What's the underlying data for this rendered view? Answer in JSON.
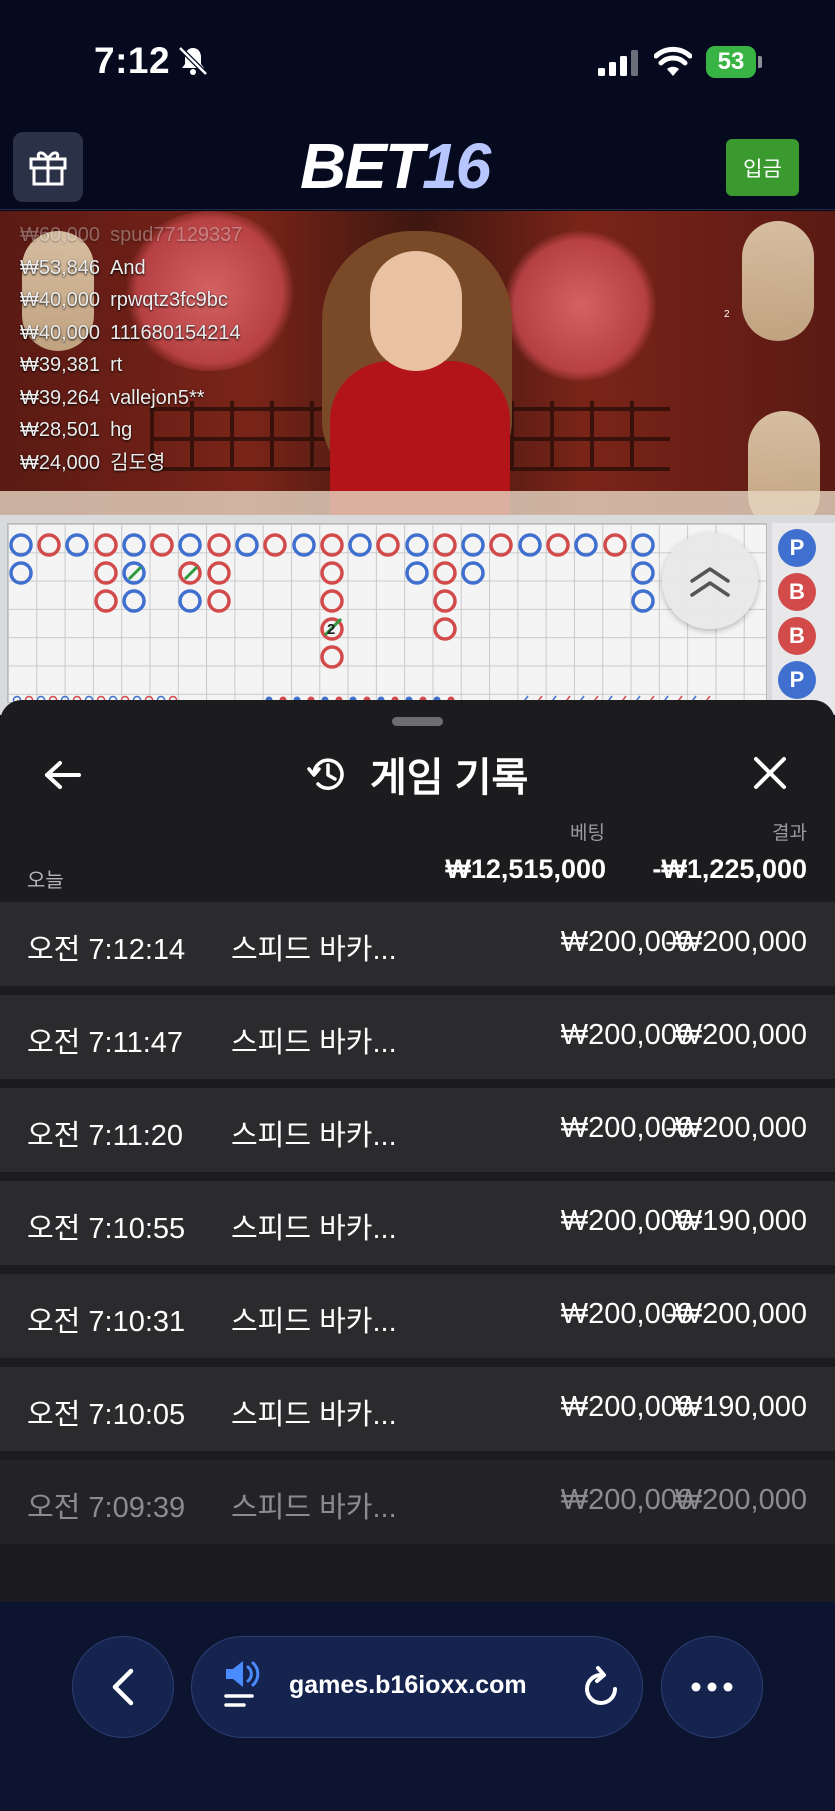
{
  "status_bar": {
    "time": "7:12",
    "battery": "53"
  },
  "header": {
    "logo_part1": "BET",
    "logo_part2": "16",
    "deposit_label": "입금"
  },
  "video": {
    "winners": [
      {
        "amount": "₩60,000",
        "name": "spud77129337"
      },
      {
        "amount": "₩53,846",
        "name": "And"
      },
      {
        "amount": "₩40,000",
        "name": "rpwqtz3fc9bc"
      },
      {
        "amount": "₩40,000",
        "name": "111680154214"
      },
      {
        "amount": "₩39,381",
        "name": "rt"
      },
      {
        "amount": "₩39,264",
        "name": "vallejon5**"
      },
      {
        "amount": "₩28,501",
        "name": "hg"
      },
      {
        "amount": "₩24,000",
        "name": "김도영"
      }
    ],
    "overlay_number": "2"
  },
  "roadmap": {
    "tie_count_label": "2",
    "side_results": [
      "P",
      "B",
      "B",
      "P"
    ]
  },
  "history": {
    "title": "게임 기록",
    "bet_col": "베팅",
    "result_col": "결과",
    "today_label": "오늘",
    "today_bet_total": "₩12,515,000",
    "today_result_total": "-₩1,225,000",
    "rows": [
      {
        "time": "오전 7:12:14",
        "game": "스피드 바카...",
        "bet": "₩200,000",
        "result": "-₩200,000"
      },
      {
        "time": "오전 7:11:47",
        "game": "스피드 바카...",
        "bet": "₩200,000",
        "result": "₩200,000"
      },
      {
        "time": "오전 7:11:20",
        "game": "스피드 바카...",
        "bet": "₩200,000",
        "result": "-₩200,000"
      },
      {
        "time": "오전 7:10:55",
        "game": "스피드 바카...",
        "bet": "₩200,000",
        "result": "₩190,000"
      },
      {
        "time": "오전 7:10:31",
        "game": "스피드 바카...",
        "bet": "₩200,000",
        "result": "-₩200,000"
      },
      {
        "time": "오전 7:10:05",
        "game": "스피드 바카...",
        "bet": "₩200,000",
        "result": "₩190,000"
      },
      {
        "time": "오전 7:09:39",
        "game": "스피드 바카...",
        "bet": "₩200,000",
        "result": "₩200,000"
      }
    ]
  },
  "browser": {
    "url": "games.b16ioxx.com"
  },
  "colors": {
    "accent_green": "#3a9a2f",
    "banker_red": "#d24a4a",
    "player_blue": "#3f6fcf",
    "sheet_bg": "#1c1c1e"
  },
  "icons": [
    "bell-slash-icon",
    "signal-icon",
    "wifi-icon",
    "gift-icon",
    "chevrons-up-icon",
    "arrow-left-icon",
    "history-icon",
    "close-icon",
    "chevron-left-icon",
    "speaker-icon",
    "reload-icon",
    "more-icon"
  ]
}
